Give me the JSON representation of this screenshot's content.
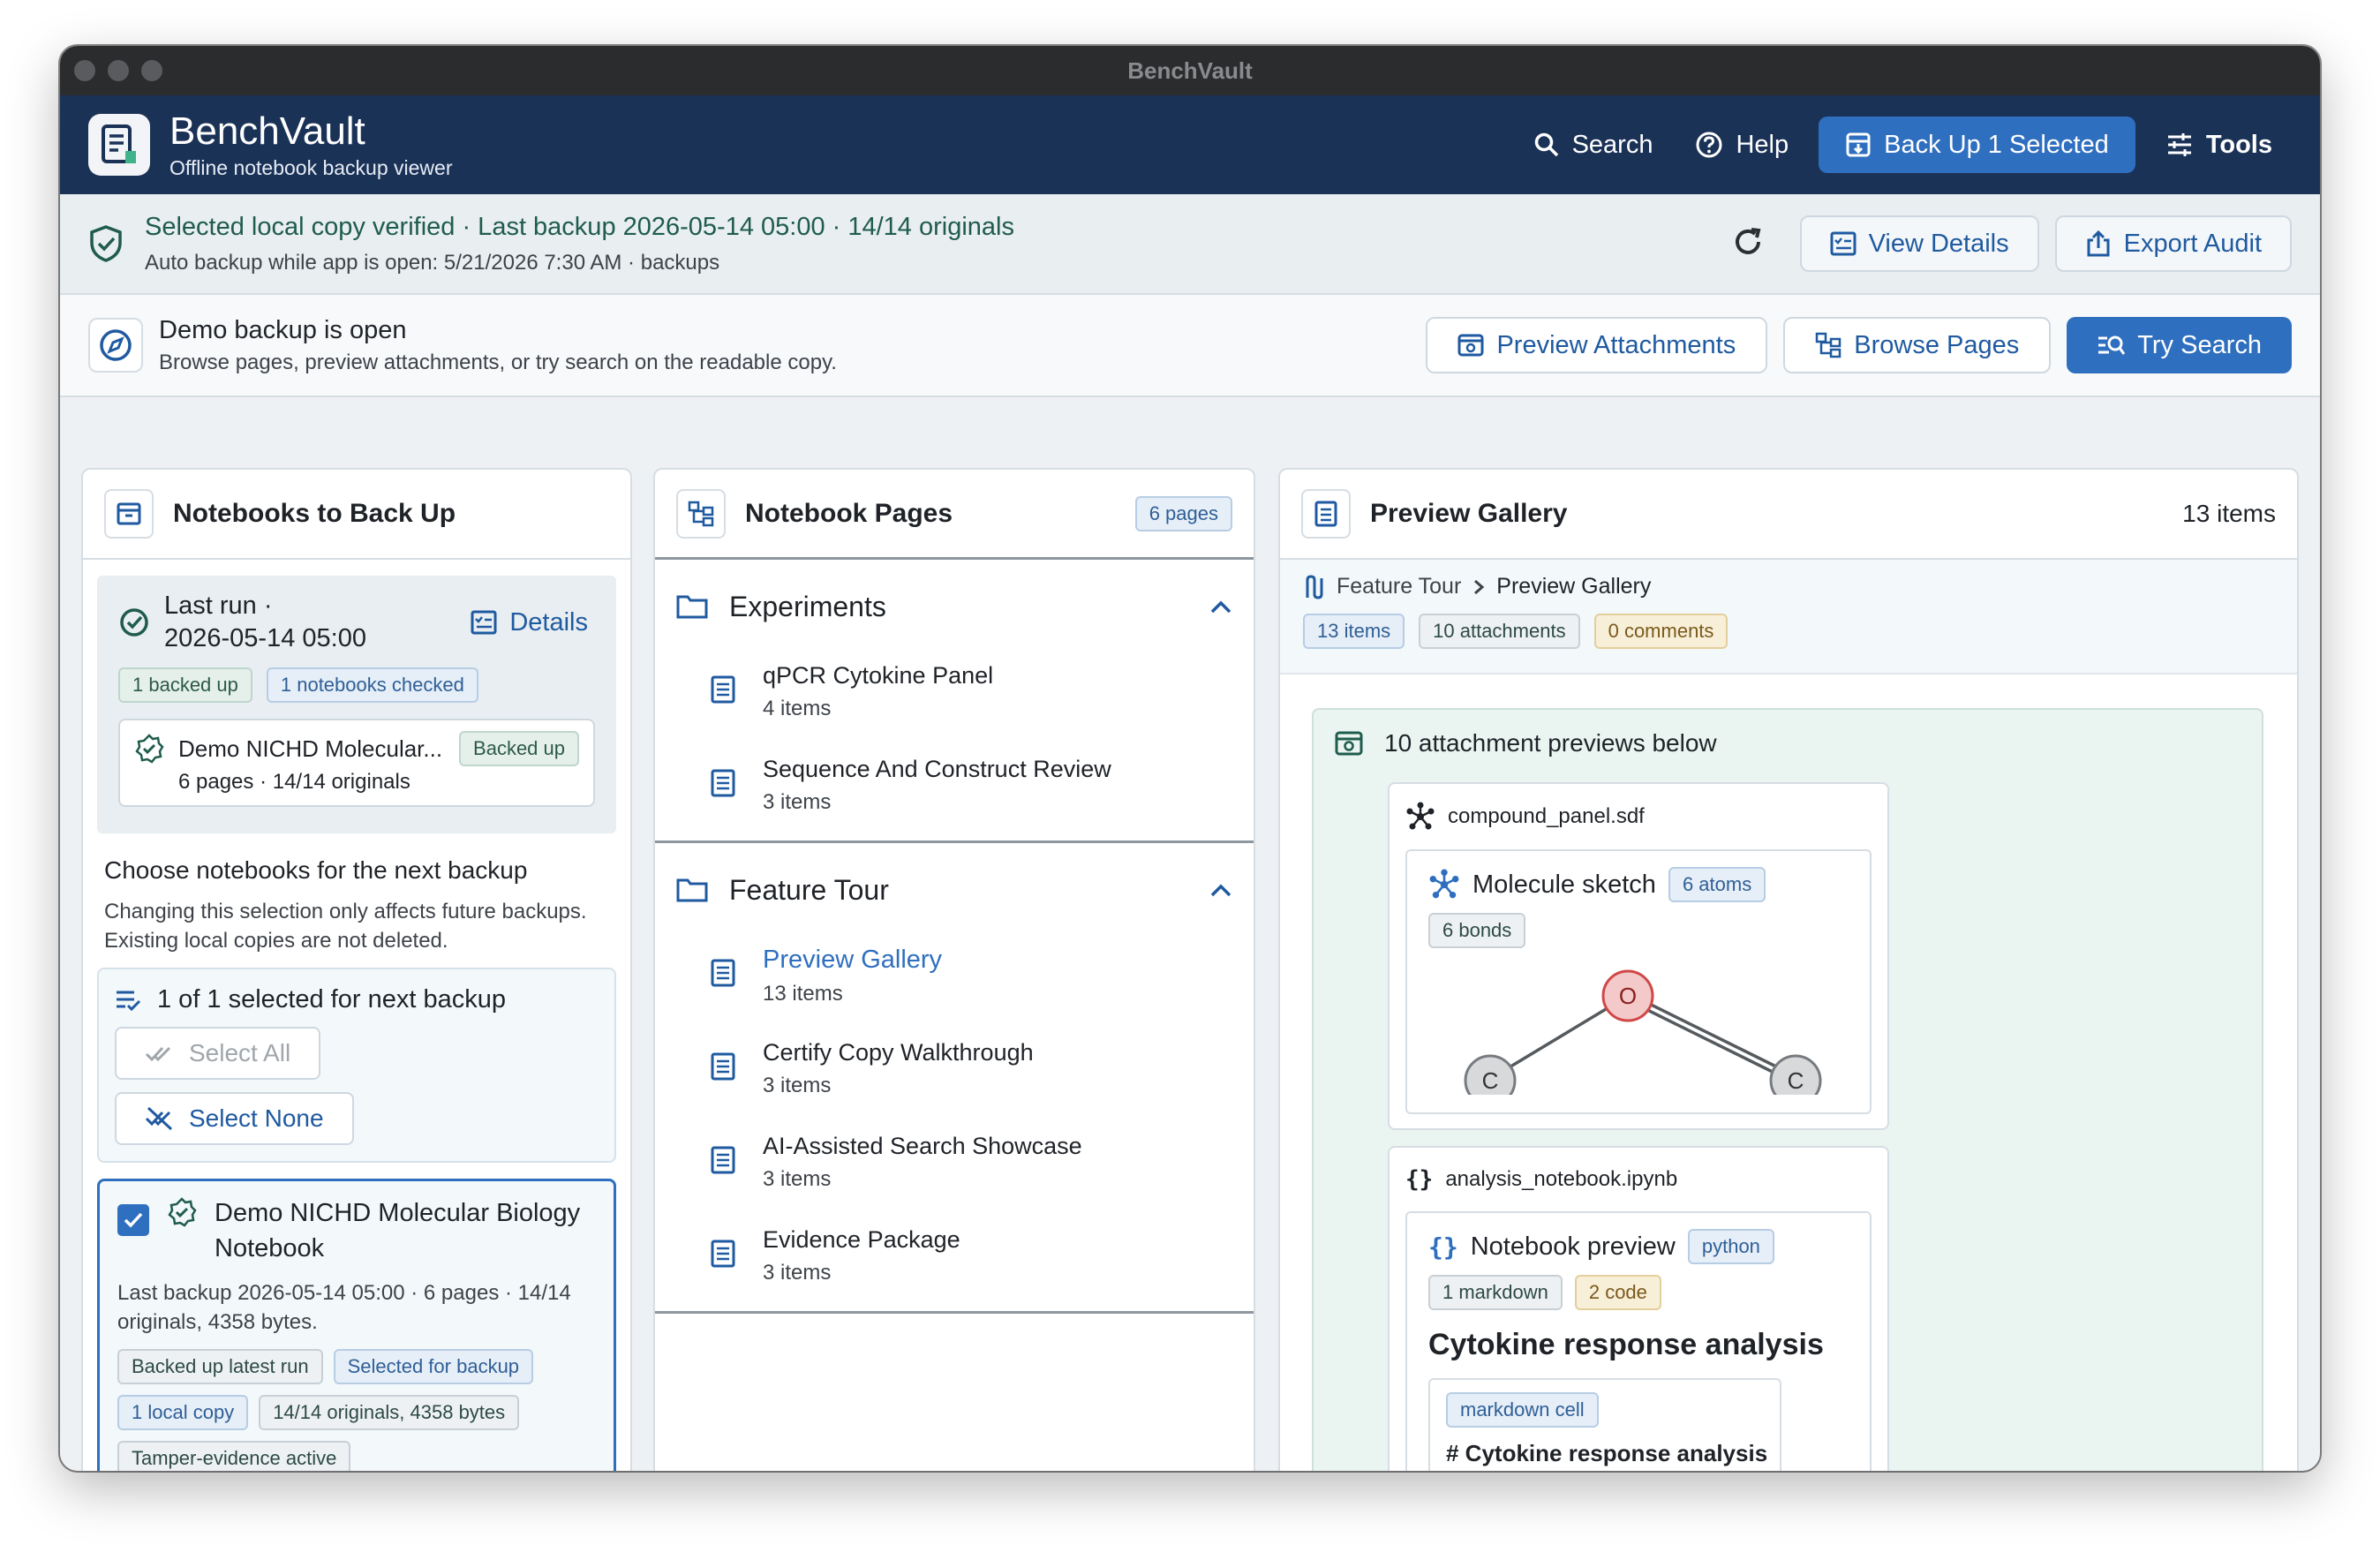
{
  "window": {
    "title": "BenchVault"
  },
  "app": {
    "name": "BenchVault",
    "subtitle": "Offline notebook backup viewer"
  },
  "toolbar": {
    "search": "Search",
    "help": "Help",
    "backup": "Back Up 1 Selected",
    "tools": "Tools"
  },
  "status": {
    "main": "Selected local copy verified · Last backup 2026-05-14 05:00 · 14/14 originals",
    "sub": "Auto backup while app is open: 5/21/2026 7:30 AM · backups",
    "view_details": "View Details",
    "export_audit": "Export Audit"
  },
  "demo": {
    "title": "Demo backup is open",
    "sub": "Browse pages, preview attachments, or try search on the readable copy.",
    "preview_attachments": "Preview Attachments",
    "browse_pages": "Browse Pages",
    "try_search": "Try Search"
  },
  "left": {
    "title": "Notebooks to Back Up",
    "last_run_label": "Last run ·",
    "last_run_time": "2026-05-14 05:00",
    "details": "Details",
    "chip_backed": "1 backed up",
    "chip_checked": "1 notebooks checked",
    "card_name": "Demo NICHD Molecular...",
    "card_meta": "6 pages · 14/14 originals",
    "card_status": "Backed up",
    "choose_title": "Choose notebooks for the next backup",
    "choose_sub": "Changing this selection only affects future backups. Existing local copies are not deleted.",
    "selected_count": "1 of 1 selected for next backup",
    "select_all": "Select All",
    "select_none": "Select None",
    "nb_name": "Demo NICHD Molecular Biology Notebook",
    "nb_meta": "Last backup 2026-05-14 05:00 · 6 pages · 14/14 originals, 4358 bytes.",
    "chips": [
      "Backed up latest run",
      "Selected for backup",
      "1 local copy",
      "14/14 originals, 4358 bytes",
      "Tamper-evidence active"
    ]
  },
  "middle": {
    "title": "Notebook Pages",
    "badge": "6 pages",
    "folders": [
      {
        "name": "Experiments",
        "pages": [
          {
            "name": "qPCR Cytokine Panel",
            "count": "4 items"
          },
          {
            "name": "Sequence And Construct Review",
            "count": "3 items"
          }
        ]
      },
      {
        "name": "Feature Tour",
        "pages": [
          {
            "name": "Preview Gallery",
            "count": "13 items"
          },
          {
            "name": "Certify Copy Walkthrough",
            "count": "3 items"
          },
          {
            "name": "AI-Assisted Search Showcase",
            "count": "3 items"
          },
          {
            "name": "Evidence Package",
            "count": "3 items"
          }
        ]
      }
    ]
  },
  "right": {
    "title": "Preview Gallery",
    "count": "13 items",
    "crumb_parent": "Feature Tour",
    "crumb_current": "Preview Gallery",
    "chip_items": "13 items",
    "chip_attachments": "10 attachments",
    "chip_comments": "0 comments",
    "attach_title": "10 attachment previews below",
    "file1": "compound_panel.sdf",
    "mol_title": "Molecule sketch",
    "mol_atoms": "6 atoms",
    "mol_bonds": "6 bonds",
    "atoms": [
      "O",
      "C",
      "C"
    ],
    "file2": "analysis_notebook.ipynb",
    "nb_title": "Notebook preview",
    "nb_lang": "python",
    "nb_markdown": "1 markdown",
    "nb_code": "2 code",
    "nb_heading": "Cytokine response analysis",
    "cell_chip": "markdown cell",
    "cell_text": "# Cytokine response analysis"
  }
}
